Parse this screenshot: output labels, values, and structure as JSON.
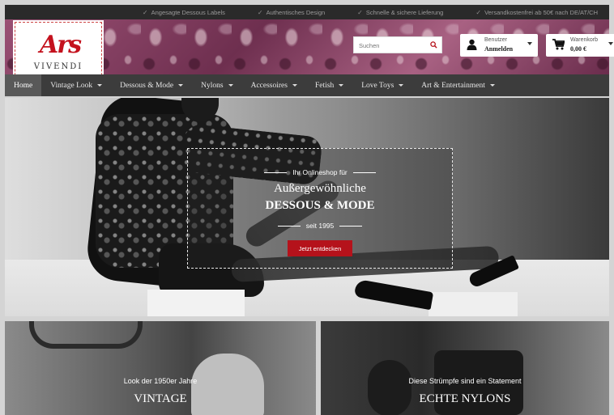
{
  "usps": [
    "Angesagte Dessous Labels",
    "Authentisches Design",
    "Schnelle & sichere Lieferung",
    "Versandkostenfrei ab 50€ nach DE/AT/CH"
  ],
  "logo": {
    "mark": "Ars",
    "name": "VIVENDI"
  },
  "search": {
    "placeholder": "Suchen",
    "icon": "search-icon"
  },
  "user": {
    "label": "Benutzer",
    "action": "Anmelden",
    "icon": "user-icon"
  },
  "cart": {
    "label": "Warenkorb",
    "total": "0,00 €",
    "icon": "cart-icon"
  },
  "nav": [
    {
      "label": "Home",
      "active": true,
      "dropdown": false
    },
    {
      "label": "Vintage Look",
      "dropdown": true
    },
    {
      "label": "Dessous & Mode",
      "dropdown": true
    },
    {
      "label": "Nylons",
      "dropdown": true
    },
    {
      "label": "Accessoires",
      "dropdown": true
    },
    {
      "label": "Fetish",
      "dropdown": true
    },
    {
      "label": "Love Toys",
      "dropdown": true
    },
    {
      "label": "Art & Entertainment",
      "dropdown": true
    }
  ],
  "hero": {
    "eyebrow": "Ihr Onlineshop für",
    "title_line1": "Außergewöhnliche",
    "title_line2": "DESSOUS & MODE",
    "since": "seit 1995",
    "cta": "Jetzt entdecken"
  },
  "tiles": [
    {
      "caption": "Look der 1950er Jahre",
      "title": "VINTAGE"
    },
    {
      "caption": "Diese Strümpfe sind ein Statement",
      "title": "ECHTE NYLONS"
    }
  ],
  "colors": {
    "accent": "#b5121b",
    "nav_bg": "#3c3c3c",
    "topbar_bg": "#2a2a2a"
  }
}
